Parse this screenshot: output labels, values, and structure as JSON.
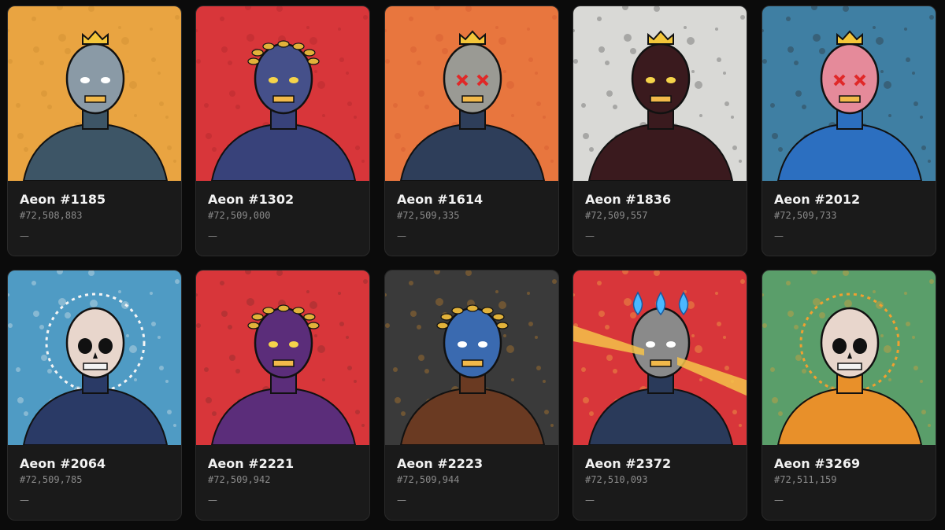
{
  "cards": [
    {
      "name": "Aeon #1185",
      "number": "#72,508,883",
      "price": "—",
      "bg": "#e9a441",
      "accent": "#c98a2d",
      "skin": "#3d5566",
      "head": "#8a9aa6",
      "crown": "gold",
      "halo": "none",
      "eyes": "white"
    },
    {
      "name": "Aeon #1302",
      "number": "#72,509,000",
      "price": "—",
      "bg": "#d8363a",
      "accent": "#a8262a",
      "skin": "#38427a",
      "head": "#45508a",
      "crown": "laurel",
      "halo": "none",
      "eyes": "yellow"
    },
    {
      "name": "Aeon #1614",
      "number": "#72,509,335",
      "price": "—",
      "bg": "#e8763e",
      "accent": "#d2562e",
      "skin": "#2e3e5a",
      "head": "#9a9a94",
      "crown": "gold",
      "halo": "none",
      "eyes": "cross"
    },
    {
      "name": "Aeon #1836",
      "number": "#72,509,557",
      "price": "—",
      "bg": "#d9d9d6",
      "accent": "#4a4a4a",
      "skin": "#3a1a1e",
      "head": "#3a1a1e",
      "crown": "gold",
      "halo": "none",
      "eyes": "yellow"
    },
    {
      "name": "Aeon #2012",
      "number": "#72,509,733",
      "price": "—",
      "bg": "#3f7fa3",
      "accent": "#2b2b2b",
      "skin": "#2c6fc0",
      "head": "#e58a9a",
      "crown": "gold",
      "halo": "none",
      "eyes": "cross"
    },
    {
      "name": "Aeon #2064",
      "number": "#72,509,785",
      "price": "—",
      "bg": "#4f9bc4",
      "accent": "#f2f2f2",
      "skin": "#2a3a66",
      "head": "#e8d6cc",
      "crown": "none",
      "halo": "white",
      "eyes": "skull"
    },
    {
      "name": "Aeon #2221",
      "number": "#72,509,942",
      "price": "—",
      "bg": "#d8363a",
      "accent": "#7a2a2a",
      "skin": "#5b2d7a",
      "head": "#5b2d7a",
      "crown": "laurel",
      "halo": "none",
      "eyes": "yellow"
    },
    {
      "name": "Aeon #2223",
      "number": "#72,509,944",
      "price": "—",
      "bg": "#3a3a3a",
      "accent": "#d08a2a",
      "skin": "#6a3a22",
      "head": "#3a6ab0",
      "crown": "laurel",
      "halo": "none",
      "eyes": "white"
    },
    {
      "name": "Aeon #2372",
      "number": "#72,510,093",
      "price": "—",
      "bg": "#d8363a",
      "accent": "#f5c24a",
      "skin": "#2a3a5a",
      "head": "#8a8a8a",
      "crown": "flames",
      "halo": "none",
      "eyes": "white"
    },
    {
      "name": "Aeon #3269",
      "number": "#72,511,159",
      "price": "—",
      "bg": "#5a9e6a",
      "accent": "#f0a030",
      "skin": "#e8902a",
      "head": "#e8d6cc",
      "crown": "none",
      "halo": "orange",
      "eyes": "skull"
    }
  ]
}
